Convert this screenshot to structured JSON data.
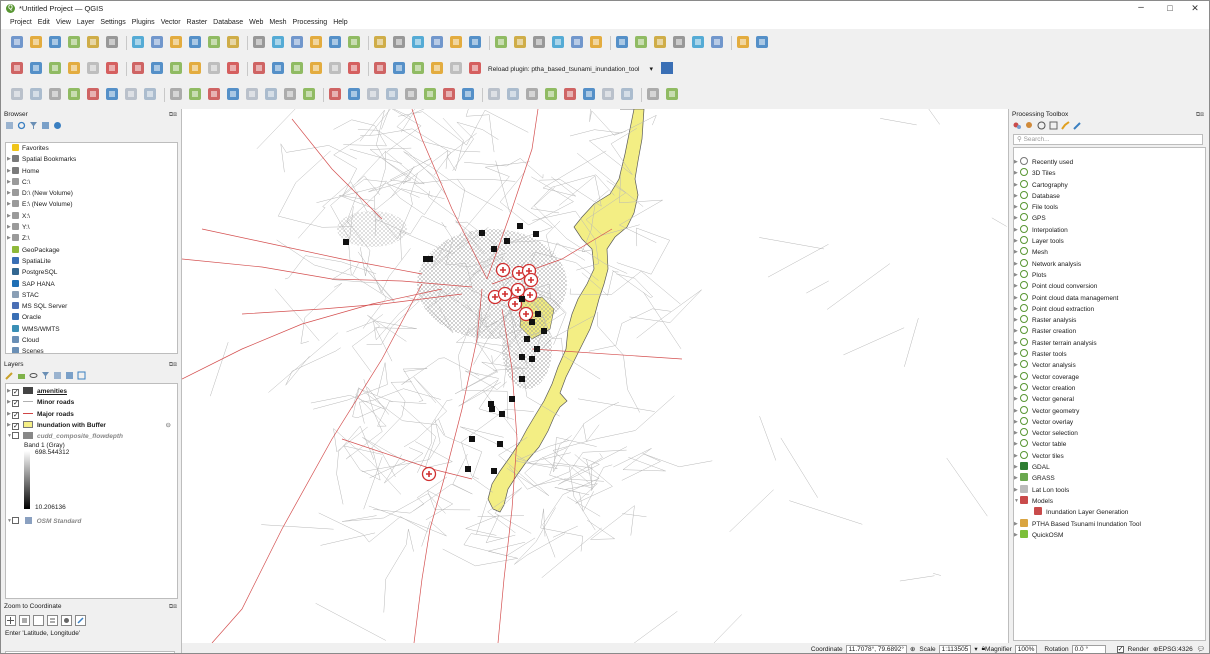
{
  "window": {
    "title": "*Untitled Project — QGIS",
    "minimize": "–",
    "maximize": "□",
    "close": "✕"
  },
  "menu": [
    "Project",
    "Edit",
    "View",
    "Layer",
    "Settings",
    "Plugins",
    "Vector",
    "Raster",
    "Database",
    "Web",
    "Mesh",
    "Processing",
    "Help"
  ],
  "toolbar": {
    "reload_plugin_label": "Reload plugin: ptha_based_tsunami_inundation_tool"
  },
  "browser": {
    "title": "Browser",
    "items": [
      {
        "label": "Favorites",
        "icon": "star-icon",
        "color": "#f0c419"
      },
      {
        "label": "Spatial Bookmarks",
        "icon": "bookmark-icon",
        "color": "#7a7a7a"
      },
      {
        "label": "Home",
        "icon": "home-icon",
        "color": "#7a7a7a"
      },
      {
        "label": "C:\\",
        "icon": "drive-icon",
        "color": "#9a9a9a"
      },
      {
        "label": "D:\\ (New Volume)",
        "icon": "drive-icon",
        "color": "#9a9a9a"
      },
      {
        "label": "E:\\ (New Volume)",
        "icon": "drive-icon",
        "color": "#9a9a9a"
      },
      {
        "label": "X:\\",
        "icon": "drive-icon",
        "color": "#9a9a9a"
      },
      {
        "label": "Y:\\",
        "icon": "drive-icon",
        "color": "#9a9a9a"
      },
      {
        "label": "Z:\\",
        "icon": "drive-icon",
        "color": "#9a9a9a"
      },
      {
        "label": "GeoPackage",
        "icon": "geopackage-icon",
        "color": "#8fb93a"
      },
      {
        "label": "SpatiaLite",
        "icon": "spatialite-icon",
        "color": "#3a6fb5"
      },
      {
        "label": "PostgreSQL",
        "icon": "postgresql-icon",
        "color": "#336791"
      },
      {
        "label": "SAP HANA",
        "icon": "sap-hana-icon",
        "color": "#1f6fb5"
      },
      {
        "label": "STAC",
        "icon": "stac-icon",
        "color": "#8a9fb5"
      },
      {
        "label": "MS SQL Server",
        "icon": "mssql-icon",
        "color": "#4a6fb5"
      },
      {
        "label": "Oracle",
        "icon": "oracle-icon",
        "color": "#3a6fb5"
      },
      {
        "label": "WMS/WMTS",
        "icon": "wms-icon",
        "color": "#3a8fb5"
      },
      {
        "label": "Cloud",
        "icon": "cloud-icon",
        "color": "#6a8fb5"
      },
      {
        "label": "Scenes",
        "icon": "scenes-icon",
        "color": "#6a8fb5"
      }
    ]
  },
  "layers": {
    "title": "Layers",
    "items": [
      {
        "label": "amenities",
        "checked": "✓",
        "bold": true,
        "underline": true,
        "color": "#444444"
      },
      {
        "label": "Minor roads",
        "checked": "✓",
        "bold": true,
        "color": "#b0b0b0"
      },
      {
        "label": "Major roads",
        "checked": "✓",
        "bold": true,
        "color": "#d04545"
      },
      {
        "label": "Inundation with Buffer",
        "checked": "✓",
        "bold": true,
        "color": "#f5ef86"
      },
      {
        "label": "cudd_composite_flowdepth",
        "checked": "",
        "italic": true,
        "color": "#888888"
      }
    ],
    "band_label": "Band 1 (Gray)",
    "max_value": "698.544312",
    "min_value": "10.206136",
    "osm_label": "OSM Standard"
  },
  "zoom": {
    "title": "Zoom to Coordinate",
    "label": "Enter 'Latitude, Longitude'"
  },
  "processing": {
    "title": "Processing Toolbox",
    "search_placeholder": "Search...",
    "items": [
      {
        "label": "Recently used",
        "icon": "clock-icon"
      },
      {
        "label": "3D Tiles",
        "icon": "qgis-algorithm-icon"
      },
      {
        "label": "Cartography",
        "icon": "qgis-algorithm-icon"
      },
      {
        "label": "Database",
        "icon": "qgis-algorithm-icon"
      },
      {
        "label": "File tools",
        "icon": "qgis-algorithm-icon"
      },
      {
        "label": "GPS",
        "icon": "qgis-algorithm-icon"
      },
      {
        "label": "Interpolation",
        "icon": "qgis-algorithm-icon"
      },
      {
        "label": "Layer tools",
        "icon": "qgis-algorithm-icon"
      },
      {
        "label": "Mesh",
        "icon": "qgis-algorithm-icon"
      },
      {
        "label": "Network analysis",
        "icon": "qgis-algorithm-icon"
      },
      {
        "label": "Plots",
        "icon": "qgis-algorithm-icon"
      },
      {
        "label": "Point cloud conversion",
        "icon": "qgis-algorithm-icon"
      },
      {
        "label": "Point cloud data management",
        "icon": "qgis-algorithm-icon"
      },
      {
        "label": "Point cloud extraction",
        "icon": "qgis-algorithm-icon"
      },
      {
        "label": "Raster analysis",
        "icon": "qgis-algorithm-icon"
      },
      {
        "label": "Raster creation",
        "icon": "qgis-algorithm-icon"
      },
      {
        "label": "Raster terrain analysis",
        "icon": "qgis-algorithm-icon"
      },
      {
        "label": "Raster tools",
        "icon": "qgis-algorithm-icon"
      },
      {
        "label": "Vector analysis",
        "icon": "qgis-algorithm-icon"
      },
      {
        "label": "Vector coverage",
        "icon": "qgis-algorithm-icon"
      },
      {
        "label": "Vector creation",
        "icon": "qgis-algorithm-icon"
      },
      {
        "label": "Vector general",
        "icon": "qgis-algorithm-icon"
      },
      {
        "label": "Vector geometry",
        "icon": "qgis-algorithm-icon"
      },
      {
        "label": "Vector overlay",
        "icon": "qgis-algorithm-icon"
      },
      {
        "label": "Vector selection",
        "icon": "qgis-algorithm-icon"
      },
      {
        "label": "Vector table",
        "icon": "qgis-algorithm-icon"
      },
      {
        "label": "Vector tiles",
        "icon": "qgis-algorithm-icon"
      },
      {
        "label": "GDAL",
        "icon": "gdal-icon"
      },
      {
        "label": "GRASS",
        "icon": "grass-icon"
      },
      {
        "label": "Lat Lon tools",
        "icon": "latlon-icon"
      },
      {
        "label": "Models",
        "icon": "models-icon"
      },
      {
        "label": "Inundation Layer Generation",
        "icon": "model-icon",
        "child": true
      },
      {
        "label": "PTHA Based Tsunami Inundation Tool",
        "icon": "ptha-icon"
      },
      {
        "label": "QuickOSM",
        "icon": "quickosm-icon"
      }
    ]
  },
  "status": {
    "coordinate_label": "Coordinate",
    "coordinate_value": "11.7078°, 79.6892°",
    "scale_label": "Scale",
    "scale_value": "1:113505",
    "magnifier_label": "Magnifier",
    "magnifier_value": "100%",
    "rotation_label": "Rotation",
    "rotation_value": "0.0 °",
    "render_label": "Render",
    "crs_label": "EPSG:4326"
  }
}
